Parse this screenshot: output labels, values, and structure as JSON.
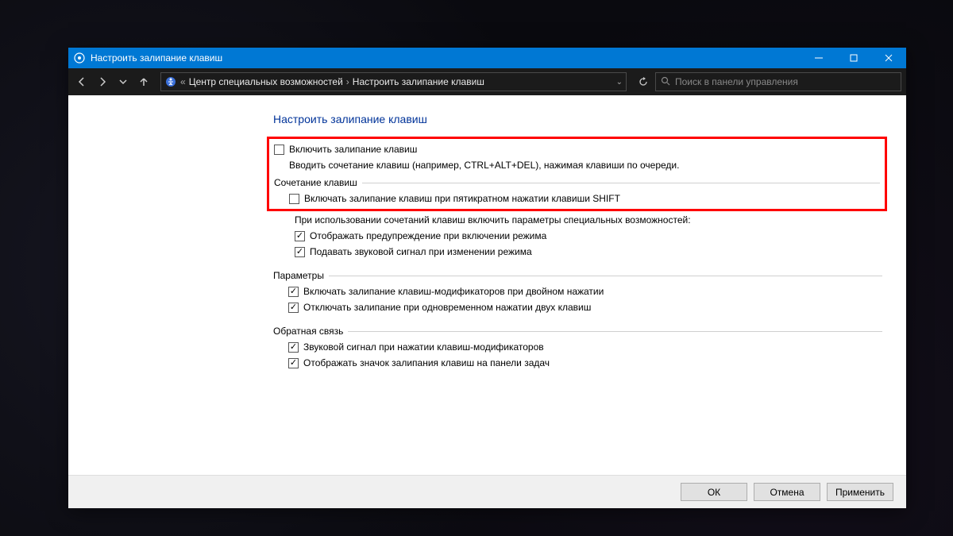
{
  "window": {
    "title": "Настроить залипание клавиш"
  },
  "breadcrumb": {
    "item1": "Центр специальных возможностей",
    "item2": "Настроить залипание клавиш"
  },
  "search": {
    "placeholder": "Поиск в панели управления"
  },
  "page": {
    "heading": "Настроить залипание клавиш",
    "enable_label": "Включить залипание клавиш",
    "enable_desc": "Вводить сочетание клавиш (например, CTRL+ALT+DEL), нажимая клавиши по очереди.",
    "group_shortcut": {
      "legend": "Сочетание клавиш",
      "cb_shift5": "Включать залипание клавиш при пятикратном нажатии клавиши SHIFT",
      "sub_text": "При использовании сочетаний клавиш включить параметры специальных возможностей:",
      "cb_warn": "Отображать предупреждение при включении режима",
      "cb_sound": "Подавать звуковой сигнал при изменении режима"
    },
    "group_params": {
      "legend": "Параметры",
      "cb_double": "Включать залипание клавиш-модификаторов при двойном нажатии",
      "cb_two": "Отключать залипание при одновременном нажатии двух клавиш"
    },
    "group_feedback": {
      "legend": "Обратная связь",
      "cb_beep": "Звуковой сигнал при нажатии клавиш-модификаторов",
      "cb_tray": "Отображать значок залипания клавиш на панели задач"
    }
  },
  "buttons": {
    "ok": "ОК",
    "cancel": "Отмена",
    "apply": "Применить"
  }
}
